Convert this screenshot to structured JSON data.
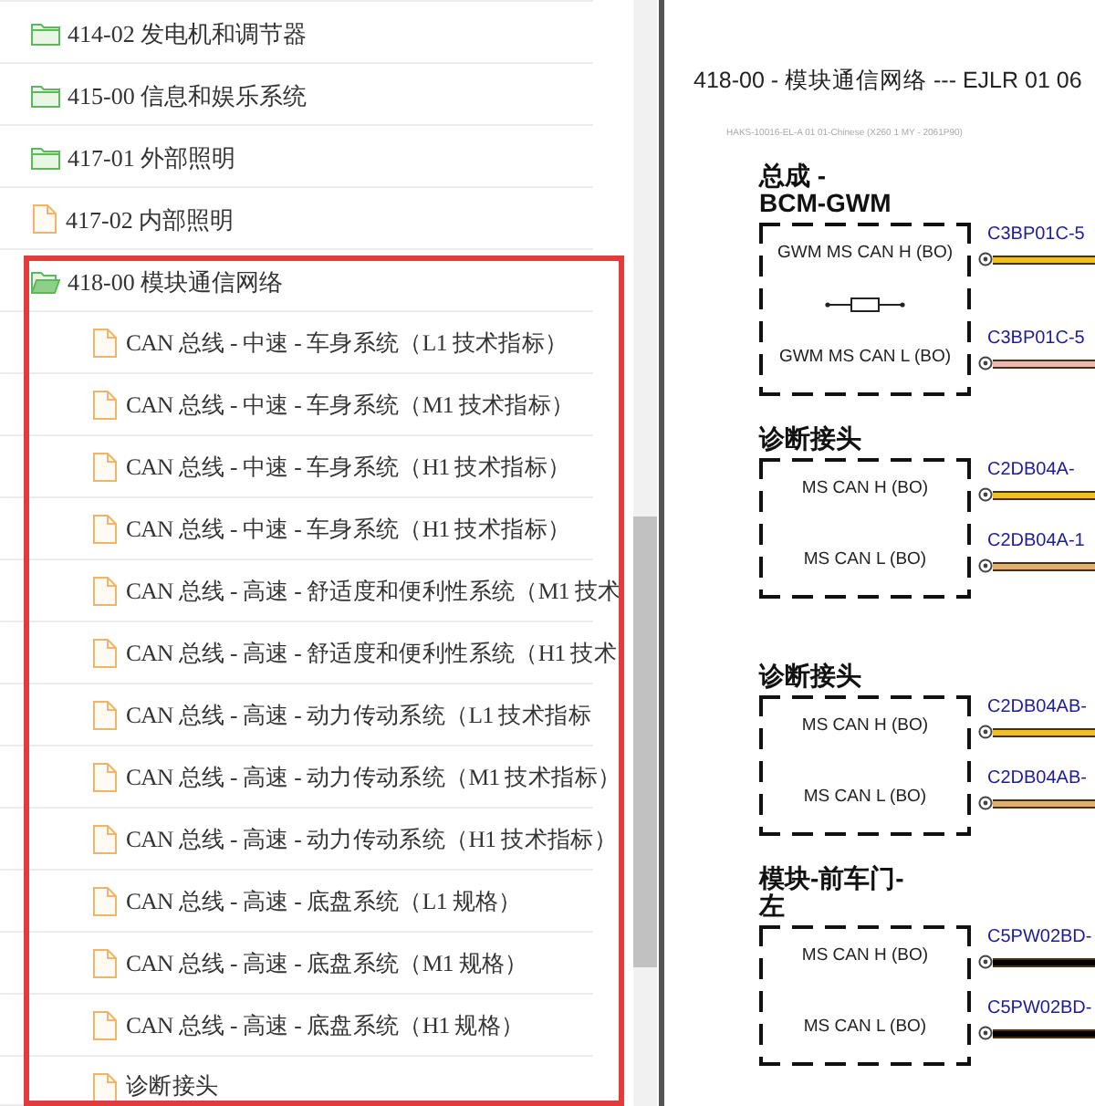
{
  "tree": [
    {
      "label": "414-02 发电机和调节器",
      "kind": "folder",
      "expanded": false,
      "highlighted": false
    },
    {
      "label": "415-00 信息和娱乐系统",
      "kind": "folder",
      "expanded": false,
      "highlighted": false
    },
    {
      "label": "417-01 外部照明",
      "kind": "folder",
      "expanded": false,
      "highlighted": false
    },
    {
      "label": "417-02 内部照明",
      "kind": "file",
      "highlighted": false
    },
    {
      "label": "418-00 模块通信网络",
      "kind": "folder",
      "expanded": true,
      "highlighted": true,
      "children": [
        {
          "label": "CAN 总线 - 中速 - 车身系统（L1 技术指标）",
          "kind": "file"
        },
        {
          "label": "CAN 总线 - 中速 - 车身系统（M1 技术指标）",
          "kind": "file"
        },
        {
          "label": "CAN 总线 - 中速 - 车身系统（H1 技术指标）",
          "kind": "file"
        },
        {
          "label": "CAN 总线 - 中速 - 车身系统（H1 技术指标）",
          "kind": "file"
        },
        {
          "label": "CAN 总线 - 高速 - 舒适度和便利性系统（M1 技术",
          "kind": "file"
        },
        {
          "label": "CAN 总线 - 高速 - 舒适度和便利性系统（H1 技术",
          "kind": "file"
        },
        {
          "label": "CAN 总线 - 高速 - 动力传动系统（L1 技术指标",
          "kind": "file"
        },
        {
          "label": "CAN 总线 - 高速 - 动力传动系统（M1 技术指标）",
          "kind": "file"
        },
        {
          "label": "CAN 总线 - 高速 - 动力传动系统（H1 技术指标）",
          "kind": "file"
        },
        {
          "label": "CAN 总线 - 高速 - 底盘系统（L1 规格）",
          "kind": "file"
        },
        {
          "label": "CAN 总线 - 高速 - 底盘系统（M1 规格）",
          "kind": "file"
        },
        {
          "label": "CAN 总线 - 高速 - 底盘系统（H1 规格）",
          "kind": "file"
        },
        {
          "label": "诊断接头",
          "kind": "file"
        }
      ]
    }
  ],
  "document": {
    "title": "418-00 - 模块通信网络 --- EJLR 01 06",
    "fine_print": "HAKS-10016-EL-A 01 01-Chinese (X260 1 MY - 2061P90)",
    "modules": [
      {
        "heading": "总成 -\nBCM-GWM",
        "items": [
          {
            "kind": "pin",
            "label": "GWM MS CAN H (BO)",
            "connector": "C3BP01C-5",
            "color": "#f0c020"
          },
          {
            "kind": "resistor"
          },
          {
            "kind": "pin",
            "label": "GWM MS CAN L (BO)",
            "connector": "C3BP01C-5",
            "color": "#ecb8b4"
          }
        ]
      },
      {
        "heading": "诊断接头",
        "items": [
          {
            "kind": "pin",
            "label": "MS CAN H (BO)",
            "connector": "C2DB04A-",
            "color": "#f0c020"
          },
          {
            "kind": "pin",
            "label": "MS CAN L (BO)",
            "connector": "C2DB04A-1",
            "color": "#e0b070"
          }
        ]
      },
      {
        "heading": "诊断接头",
        "items": [
          {
            "kind": "pin",
            "label": "MS CAN H (BO)",
            "connector": "C2DB04AB-",
            "color": "#f0c020"
          },
          {
            "kind": "pin",
            "label": "MS CAN L (BO)",
            "connector": "C2DB04AB-",
            "color": "#e0b070"
          }
        ]
      },
      {
        "heading": "模块-前车门-\n左",
        "items": [
          {
            "kind": "pin",
            "label": "MS CAN H (BO)",
            "connector": "C5PW02BD-",
            "color": "#000000"
          },
          {
            "kind": "pin",
            "label": "MS CAN L (BO)",
            "connector": "C5PW02BD-",
            "color": "#000000"
          }
        ]
      }
    ]
  }
}
